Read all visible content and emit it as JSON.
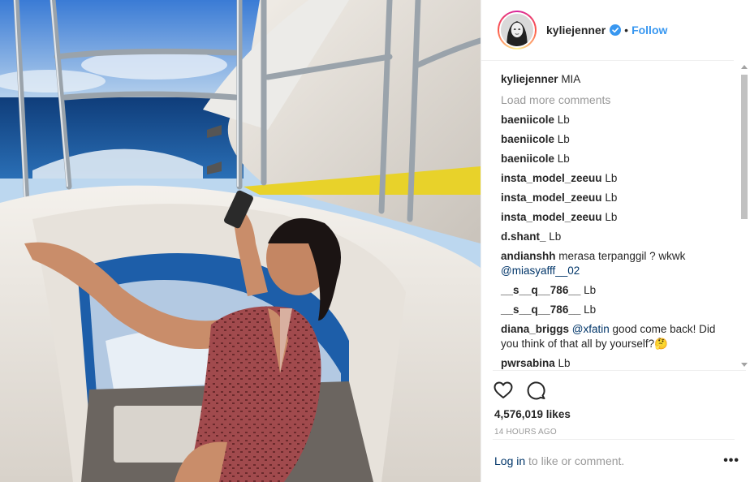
{
  "post": {
    "photo_alt": "",
    "header": {
      "username": "kyliejenner",
      "separator": "•",
      "follow_label": "Follow"
    },
    "caption": {
      "username": "kyliejenner",
      "text": "MIA"
    },
    "load_more": "Load more comments",
    "comments": [
      {
        "username": "baeniicole",
        "text": "Lb"
      },
      {
        "username": "baeniicole",
        "text": "Lb"
      },
      {
        "username": "baeniicole",
        "text": "Lb"
      },
      {
        "username": "insta_model_zeeuu",
        "text": "Lb"
      },
      {
        "username": "insta_model_zeeuu",
        "text": "Lb"
      },
      {
        "username": "insta_model_zeeuu",
        "text": "Lb"
      },
      {
        "username": "d.shant_",
        "text": "Lb"
      },
      {
        "username": "andianshh",
        "text": "merasa terpanggil ? wkwk",
        "mention": "@miasyafff__02"
      },
      {
        "username": "__s__q__786__",
        "text": "Lb"
      },
      {
        "username": "__s__q__786__",
        "text": "Lb"
      },
      {
        "username": "diana_briggs",
        "mention": "@xfatin",
        "text": "good come back! Did you think of that all by yourself?🤔"
      },
      {
        "username": "pwrsabina",
        "text": "Lb"
      }
    ],
    "likes": "4,576,019 likes",
    "time_ago": "14 HOURS AGO",
    "login": {
      "link": "Log in",
      "rest": "to like or comment."
    },
    "more_label": "•••"
  },
  "icons": {
    "like": "heart-icon",
    "comment": "comment-icon",
    "verified": "verified-badge-icon",
    "more": "more-options-icon"
  },
  "colors": {
    "link": "#3897f0",
    "mention": "#003569",
    "muted": "#999999",
    "verified": "#3897f0"
  }
}
